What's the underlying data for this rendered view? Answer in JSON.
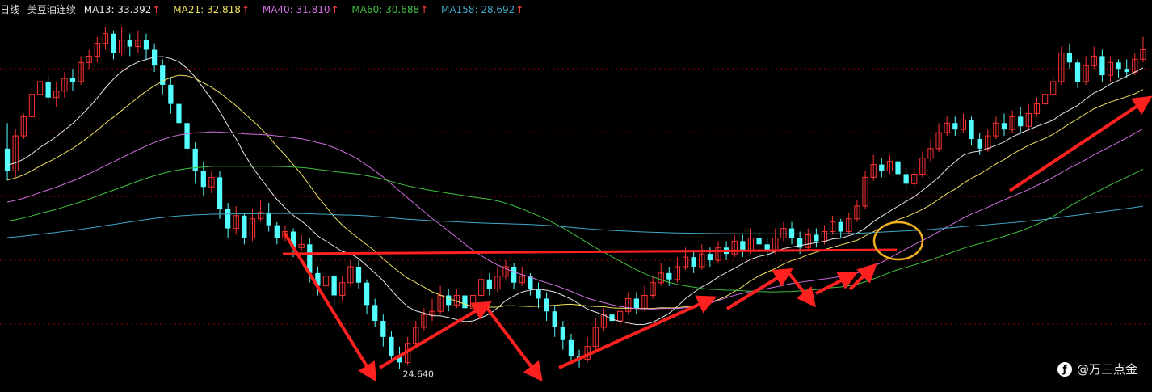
{
  "legend": {
    "period": "日线",
    "instrument": "美豆油连续",
    "items": [
      {
        "label": "MA13: 33.392",
        "arrow": "↑",
        "color": "#e6e6e6",
        "arrow_color": "#ff4040"
      },
      {
        "label": "MA21: 32.818",
        "arrow": "↑",
        "color": "#f0e060",
        "arrow_color": "#ff4040"
      },
      {
        "label": "MA40: 31.810",
        "arrow": "↑",
        "color": "#d070e0",
        "arrow_color": "#ff4040"
      },
      {
        "label": "MA60: 30.688",
        "arrow": "↑",
        "color": "#40c040",
        "arrow_color": "#ff4040"
      },
      {
        "label": "MA158: 28.692",
        "arrow": "↑",
        "color": "#40a8c8",
        "arrow_color": "#ff4040"
      }
    ]
  },
  "watermark": {
    "icon": "toutiao-logo-icon",
    "text": "@万三点金"
  },
  "colors": {
    "background": "#000000",
    "up_candle": "#ff3232",
    "down_candle": "#54ffff",
    "gridline": "#8b0000",
    "annotation": "#ff2020",
    "circle": "#f0b020"
  },
  "chart_data": {
    "type": "candlestick",
    "title": "美豆油连续 日线",
    "ylim": [
      24.0,
      35.6
    ],
    "grid": "horizontal dashed",
    "min_label": "24.640",
    "min_value": 24.64,
    "candles": [
      [
        31.5,
        30.8,
        32.3,
        30.5
      ],
      [
        30.8,
        31.9,
        32.1,
        30.6
      ],
      [
        31.9,
        32.5,
        32.6,
        31.8
      ],
      [
        32.5,
        33.2,
        33.4,
        32.3
      ],
      [
        33.2,
        33.6,
        33.9,
        33.0
      ],
      [
        33.6,
        33.1,
        33.8,
        32.9
      ],
      [
        33.1,
        33.3,
        33.6,
        32.8
      ],
      [
        33.3,
        33.7,
        33.9,
        33.1
      ],
      [
        33.7,
        33.6,
        34.0,
        33.3
      ],
      [
        33.6,
        34.2,
        34.4,
        33.5
      ],
      [
        34.2,
        34.4,
        34.6,
        34.0
      ],
      [
        34.4,
        34.8,
        35.0,
        34.2
      ],
      [
        34.8,
        35.1,
        35.3,
        34.6
      ],
      [
        35.1,
        34.5,
        35.2,
        34.3
      ],
      [
        34.5,
        34.9,
        35.3,
        34.4
      ],
      [
        34.9,
        34.7,
        35.1,
        34.4
      ],
      [
        34.7,
        34.9,
        35.2,
        34.5
      ],
      [
        34.9,
        34.6,
        35.1,
        34.3
      ],
      [
        34.6,
        34.1,
        34.8,
        33.9
      ],
      [
        34.1,
        33.5,
        34.3,
        33.2
      ],
      [
        33.5,
        32.9,
        33.7,
        32.6
      ],
      [
        32.9,
        32.3,
        33.1,
        32.0
      ],
      [
        32.3,
        31.5,
        32.5,
        31.2
      ],
      [
        31.5,
        30.8,
        31.7,
        30.4
      ],
      [
        30.8,
        30.3,
        31.1,
        30.0
      ],
      [
        30.3,
        30.6,
        30.8,
        30.1
      ],
      [
        30.6,
        29.6,
        30.8,
        29.3
      ],
      [
        29.6,
        29.0,
        29.8,
        28.7
      ],
      [
        29.0,
        29.4,
        29.7,
        28.8
      ],
      [
        29.4,
        28.7,
        29.5,
        28.5
      ],
      [
        28.7,
        29.3,
        29.6,
        28.6
      ],
      [
        29.3,
        29.5,
        29.9,
        29.2
      ],
      [
        29.5,
        29.1,
        29.8,
        28.9
      ],
      [
        29.1,
        28.7,
        29.2,
        28.5
      ],
      [
        28.7,
        28.9,
        29.1,
        28.6
      ],
      [
        28.9,
        28.4,
        29.0,
        28.1
      ],
      [
        28.4,
        28.5,
        28.8,
        28.3
      ],
      [
        28.5,
        27.6,
        28.7,
        27.3
      ],
      [
        27.6,
        27.2,
        27.8,
        26.9
      ],
      [
        27.2,
        27.5,
        27.8,
        27.1
      ],
      [
        27.5,
        26.9,
        27.6,
        26.6
      ],
      [
        26.9,
        27.3,
        27.5,
        26.7
      ],
      [
        27.3,
        27.8,
        28.0,
        27.2
      ],
      [
        27.8,
        27.3,
        28.0,
        27.1
      ],
      [
        27.3,
        26.6,
        27.4,
        26.3
      ],
      [
        26.6,
        26.1,
        26.8,
        25.9
      ],
      [
        26.1,
        25.6,
        26.3,
        25.3
      ],
      [
        25.6,
        25.0,
        25.8,
        24.8
      ],
      [
        25.0,
        24.8,
        25.3,
        24.6
      ],
      [
        24.8,
        25.4,
        25.6,
        24.7
      ],
      [
        25.4,
        25.9,
        26.1,
        25.3
      ],
      [
        25.9,
        26.3,
        26.5,
        25.8
      ],
      [
        26.3,
        26.4,
        26.8,
        26.1
      ],
      [
        26.4,
        26.9,
        27.2,
        26.3
      ],
      [
        26.9,
        26.6,
        27.1,
        26.4
      ],
      [
        26.6,
        26.9,
        27.1,
        26.5
      ],
      [
        26.9,
        26.5,
        27.0,
        26.3
      ],
      [
        26.5,
        26.9,
        27.1,
        26.4
      ],
      [
        26.9,
        27.4,
        27.7,
        26.8
      ],
      [
        27.4,
        27.1,
        27.6,
        26.9
      ],
      [
        27.1,
        27.5,
        27.8,
        27.0
      ],
      [
        27.5,
        27.8,
        28.0,
        27.4
      ],
      [
        27.8,
        27.3,
        27.9,
        27.1
      ],
      [
        27.3,
        27.5,
        27.8,
        27.2
      ],
      [
        27.5,
        27.1,
        27.6,
        26.9
      ],
      [
        27.1,
        26.8,
        27.3,
        26.5
      ],
      [
        26.8,
        26.4,
        27.0,
        26.1
      ],
      [
        26.4,
        25.9,
        26.6,
        25.6
      ],
      [
        25.9,
        25.5,
        26.1,
        25.2
      ],
      [
        25.5,
        25.0,
        25.7,
        24.8
      ],
      [
        25.0,
        24.9,
        25.2,
        24.64
      ],
      [
        24.9,
        25.3,
        25.6,
        24.8
      ],
      [
        25.3,
        25.9,
        26.2,
        25.2
      ],
      [
        25.9,
        26.3,
        26.5,
        25.8
      ],
      [
        26.3,
        26.1,
        26.6,
        25.9
      ],
      [
        26.1,
        26.4,
        26.7,
        26.0
      ],
      [
        26.4,
        26.8,
        27.0,
        26.3
      ],
      [
        26.8,
        26.5,
        27.0,
        26.3
      ],
      [
        26.5,
        26.9,
        27.2,
        26.4
      ],
      [
        26.9,
        27.3,
        27.5,
        26.8
      ],
      [
        27.3,
        27.6,
        27.9,
        27.2
      ],
      [
        27.6,
        27.4,
        27.8,
        27.2
      ],
      [
        27.4,
        27.8,
        28.1,
        27.3
      ],
      [
        27.8,
        28.1,
        28.4,
        27.7
      ],
      [
        28.1,
        27.8,
        28.3,
        27.6
      ],
      [
        27.8,
        28.2,
        28.5,
        27.7
      ],
      [
        28.2,
        28.0,
        28.4,
        27.8
      ],
      [
        28.0,
        28.4,
        28.6,
        27.9
      ],
      [
        28.4,
        28.2,
        28.6,
        28.0
      ],
      [
        28.2,
        28.6,
        28.8,
        28.1
      ],
      [
        28.6,
        28.3,
        28.8,
        28.1
      ],
      [
        28.3,
        28.7,
        29.0,
        28.2
      ],
      [
        28.7,
        28.5,
        28.9,
        28.3
      ],
      [
        28.5,
        28.3,
        28.7,
        28.1
      ],
      [
        28.3,
        28.7,
        29.0,
        28.2
      ],
      [
        28.7,
        29.0,
        29.2,
        28.6
      ],
      [
        29.0,
        28.7,
        29.2,
        28.5
      ],
      [
        28.7,
        28.4,
        28.9,
        28.2
      ],
      [
        28.4,
        28.8,
        29.0,
        28.3
      ],
      [
        28.8,
        28.6,
        29.0,
        28.4
      ],
      [
        28.6,
        28.9,
        29.1,
        28.5
      ],
      [
        28.9,
        29.2,
        29.4,
        28.8
      ],
      [
        29.2,
        28.9,
        29.3,
        28.7
      ],
      [
        28.9,
        29.3,
        29.5,
        28.8
      ],
      [
        29.3,
        29.7,
        29.9,
        29.2
      ],
      [
        29.7,
        30.6,
        30.8,
        29.6
      ],
      [
        30.6,
        31.0,
        31.3,
        30.5
      ],
      [
        31.0,
        30.8,
        31.2,
        30.6
      ],
      [
        30.8,
        31.1,
        31.3,
        30.7
      ],
      [
        31.1,
        30.7,
        31.2,
        30.5
      ],
      [
        30.7,
        30.4,
        30.9,
        30.2
      ],
      [
        30.4,
        30.7,
        30.9,
        30.3
      ],
      [
        30.7,
        31.2,
        31.4,
        30.6
      ],
      [
        31.2,
        31.5,
        31.8,
        31.1
      ],
      [
        31.5,
        32.0,
        32.3,
        31.4
      ],
      [
        32.0,
        32.3,
        32.5,
        31.9
      ],
      [
        32.3,
        32.1,
        32.5,
        31.9
      ],
      [
        32.1,
        32.4,
        32.6,
        32.0
      ],
      [
        32.4,
        31.8,
        32.5,
        31.6
      ],
      [
        31.8,
        31.5,
        32.0,
        31.3
      ],
      [
        31.5,
        31.9,
        32.1,
        31.4
      ],
      [
        31.9,
        32.3,
        32.5,
        31.8
      ],
      [
        32.3,
        32.1,
        32.6,
        31.9
      ],
      [
        32.1,
        32.5,
        32.7,
        32.0
      ],
      [
        32.5,
        32.2,
        32.8,
        32.0
      ],
      [
        32.2,
        32.6,
        32.9,
        32.1
      ],
      [
        32.6,
        32.9,
        33.1,
        32.5
      ],
      [
        32.9,
        33.2,
        33.5,
        32.8
      ],
      [
        33.2,
        33.6,
        33.8,
        33.1
      ],
      [
        33.6,
        34.5,
        34.7,
        33.5
      ],
      [
        34.5,
        34.2,
        34.8,
        34.0
      ],
      [
        34.2,
        33.6,
        34.3,
        33.4
      ],
      [
        33.6,
        34.1,
        34.4,
        33.5
      ],
      [
        34.1,
        34.4,
        34.7,
        34.0
      ],
      [
        34.4,
        33.8,
        34.6,
        33.6
      ],
      [
        33.8,
        34.2,
        34.4,
        33.6
      ],
      [
        34.2,
        34.0,
        34.3,
        33.7
      ],
      [
        34.0,
        33.9,
        34.3,
        33.7
      ],
      [
        33.9,
        34.3,
        34.5,
        33.8
      ],
      [
        34.3,
        34.6,
        35.0,
        34.2
      ]
    ]
  }
}
